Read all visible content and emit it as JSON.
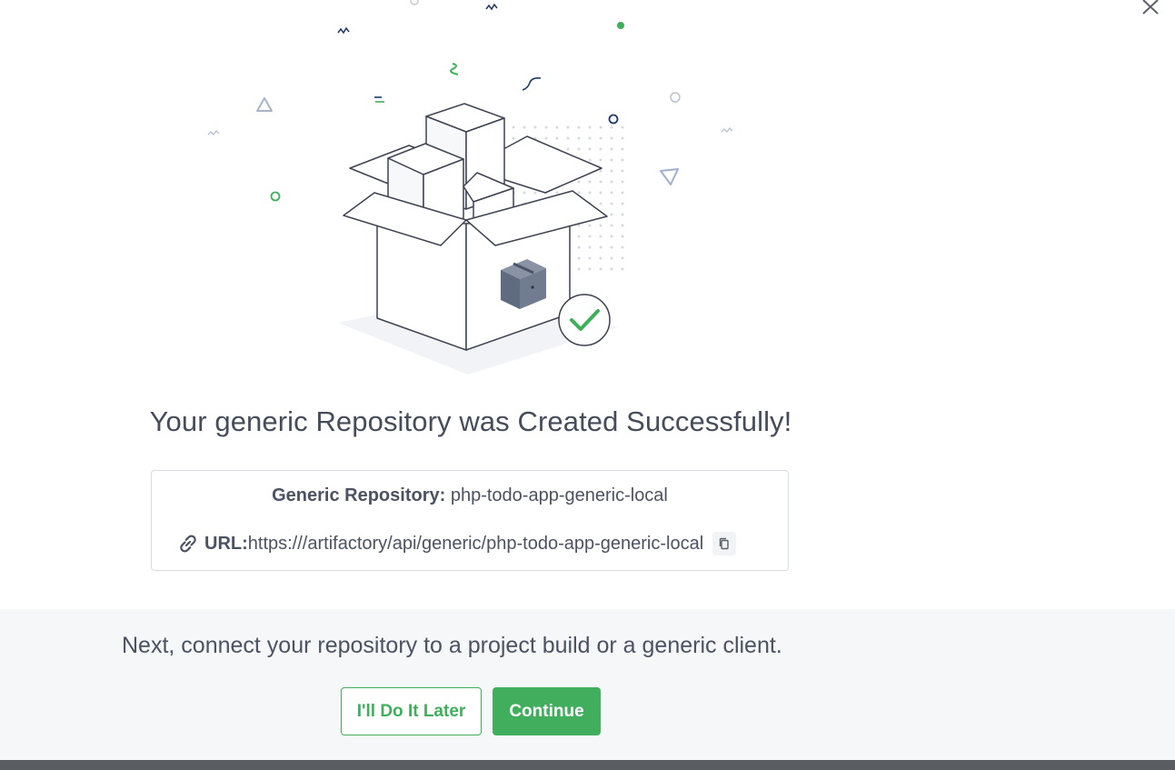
{
  "dialog": {
    "title": "Your generic Repository was Created Successfully!",
    "close_icon": "close-icon"
  },
  "illustration": {
    "icon": "open-box-with-checkmark-illustration",
    "colors": {
      "accent_green": "#3eb05a",
      "line": "#3d4350",
      "navy": "#1f3a63"
    }
  },
  "repository": {
    "name_label": "Generic Repository:",
    "name_value": "php-todo-app-generic-local",
    "url_label": "URL:",
    "url_value": "https:///artifactory/api/generic/php-todo-app-generic-local",
    "link_icon": "link-icon",
    "copy_icon": "copy-icon"
  },
  "footer": {
    "next_text": "Next, connect your repository to a project build or a generic client.",
    "later_label": "I'll Do It Later",
    "continue_label": "Continue"
  },
  "colors": {
    "primary_green": "#40ae5c",
    "footer_bg": "#f6f7f9",
    "text": "#4b5261",
    "bottom_bar": "#5a5e63"
  }
}
